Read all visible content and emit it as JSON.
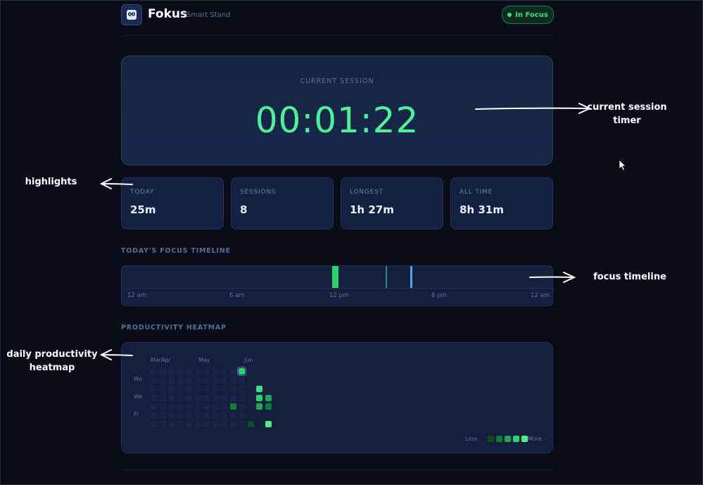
{
  "app": {
    "name": "Fokus",
    "subtitle": "Smart Stand",
    "status": "In Focus",
    "colors": {
      "accent": "#4ff09a",
      "background": "#0a0d18",
      "card": "#15203f",
      "status_green": "#3ee07f"
    }
  },
  "session": {
    "label": "CURRENT SESSION",
    "time": "00:01:22"
  },
  "stats": [
    {
      "label": "TODAY",
      "value": "25m"
    },
    {
      "label": "SESSIONS",
      "value": "8"
    },
    {
      "label": "LONGEST",
      "value": "1h 27m"
    },
    {
      "label": "ALL TIME",
      "value": "8h 31m"
    }
  ],
  "timeline": {
    "title": "TODAY'S FOCUS TIMELINE",
    "ticks": [
      "12 am",
      "6 am",
      "12 pm",
      "6 pm",
      "12 am"
    ]
  },
  "heatmap": {
    "title": "PRODUCTIVITY HEATMAP",
    "months": [
      "Mar",
      "Apr",
      "May",
      "Jun"
    ],
    "days": [
      "Mo",
      "We",
      "Fr"
    ],
    "legend_less": "Less",
    "legend_more": "More"
  },
  "annotations": {
    "session_timer_line1": "current session",
    "session_timer_line2": "timer",
    "highlights": "highlights",
    "focus_timeline": "focus timeline",
    "heatmap_line1": "daily productivity",
    "heatmap_line2": "heatmap"
  },
  "icons": {
    "logo": "owl-icon",
    "status": "status-dot-icon",
    "cursor": "mouse-pointer-icon"
  }
}
